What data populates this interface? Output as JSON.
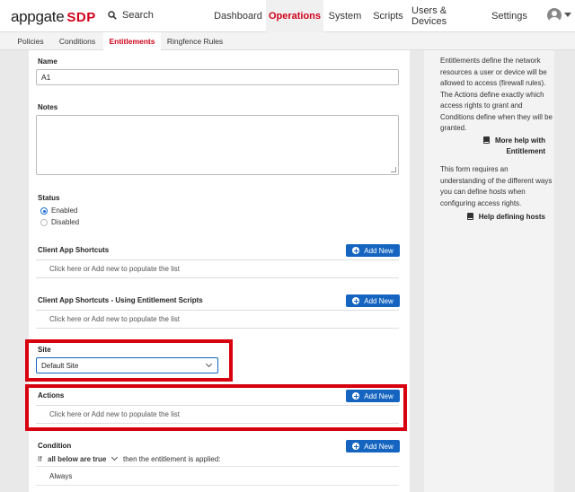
{
  "brand": {
    "logo_text": "appgate",
    "logo_suffix": "SDP"
  },
  "search": {
    "label": "Search"
  },
  "nav": [
    {
      "label": "Dashboard"
    },
    {
      "label": "Operations"
    },
    {
      "label": "System"
    },
    {
      "label": "Scripts"
    },
    {
      "label": "Users & Devices"
    },
    {
      "label": "Settings"
    }
  ],
  "subnav": [
    {
      "label": "Policies"
    },
    {
      "label": "Conditions"
    },
    {
      "label": "Entitlements"
    },
    {
      "label": "Ringfence Rules"
    }
  ],
  "form": {
    "name_label": "Name",
    "name_value": "A1",
    "notes_label": "Notes",
    "notes_value": "",
    "status_label": "Status",
    "status_enabled": "Enabled",
    "status_disabled": "Disabled",
    "status_selected": "Enabled",
    "shortcuts_label": "Client App Shortcuts",
    "shortcuts_scripts_label": "Client App Shortcuts - Using Entitlement Scripts",
    "empty_list": "Click here or Add new to populate the list",
    "add_new": "Add New",
    "site_label": "Site",
    "site_value": "Default Site",
    "actions_label": "Actions",
    "condition_label": "Condition",
    "condition_if": "If",
    "condition_mode": "all below are true",
    "condition_then": "then the entitlement is applied:",
    "condition_item": "Always"
  },
  "help": {
    "text1": "Entitlements define the network resources a user or device will be allowed to access (firewall rules). The Actions define exactly which access rights to grant and Conditions define when they will be granted.",
    "link1": "More help with Entitlement",
    "text2": "This form requires an understanding of the different ways you can define hosts when configuring access rights.",
    "link2": "Help defining hosts"
  },
  "colors": {
    "accent": "#d0021b",
    "primary": "#1565c0",
    "highlight_box": "#d7000f"
  }
}
